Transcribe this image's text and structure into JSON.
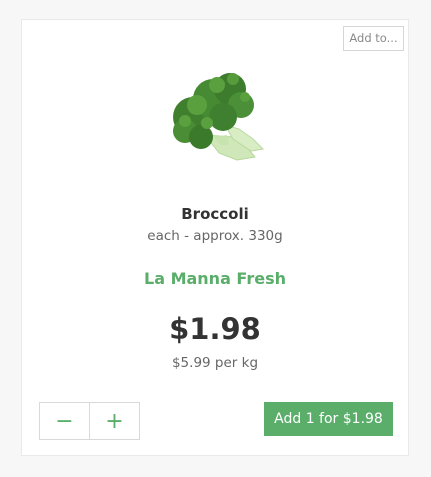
{
  "card": {
    "add_to_label": "Add to...",
    "image_icon": "broccoli-image",
    "title": "Broccoli",
    "subtitle": "each - approx. 330g",
    "brand": "La Manna Fresh",
    "price": "$1.98",
    "unit_price": "$5.99 per kg",
    "stepper": {
      "minus_label": "−",
      "plus_label": "+"
    },
    "add_button_label": "Add 1 for $1.98",
    "colors": {
      "accent": "#5aae6a",
      "text": "#333333",
      "muted": "#666666"
    }
  }
}
